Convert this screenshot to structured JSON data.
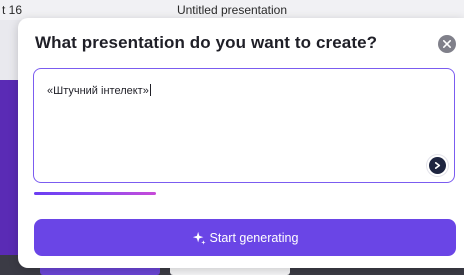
{
  "backdrop": {
    "left_tab_label": "t 16",
    "document_title": "Untitled presentation"
  },
  "modal": {
    "title": "What presentation do you want to create?",
    "close_icon": "close-icon",
    "prompt": {
      "value": "«Штучний інтелект»",
      "assistant_icon": "assistant-logo-icon"
    },
    "progress": 0.28,
    "generate_button": {
      "label": "Start generating",
      "icon": "sparkle-icon"
    }
  },
  "colors": {
    "accent": "#6a45e6",
    "border_focus": "#7b5cf0",
    "close_bg": "#80808a"
  }
}
